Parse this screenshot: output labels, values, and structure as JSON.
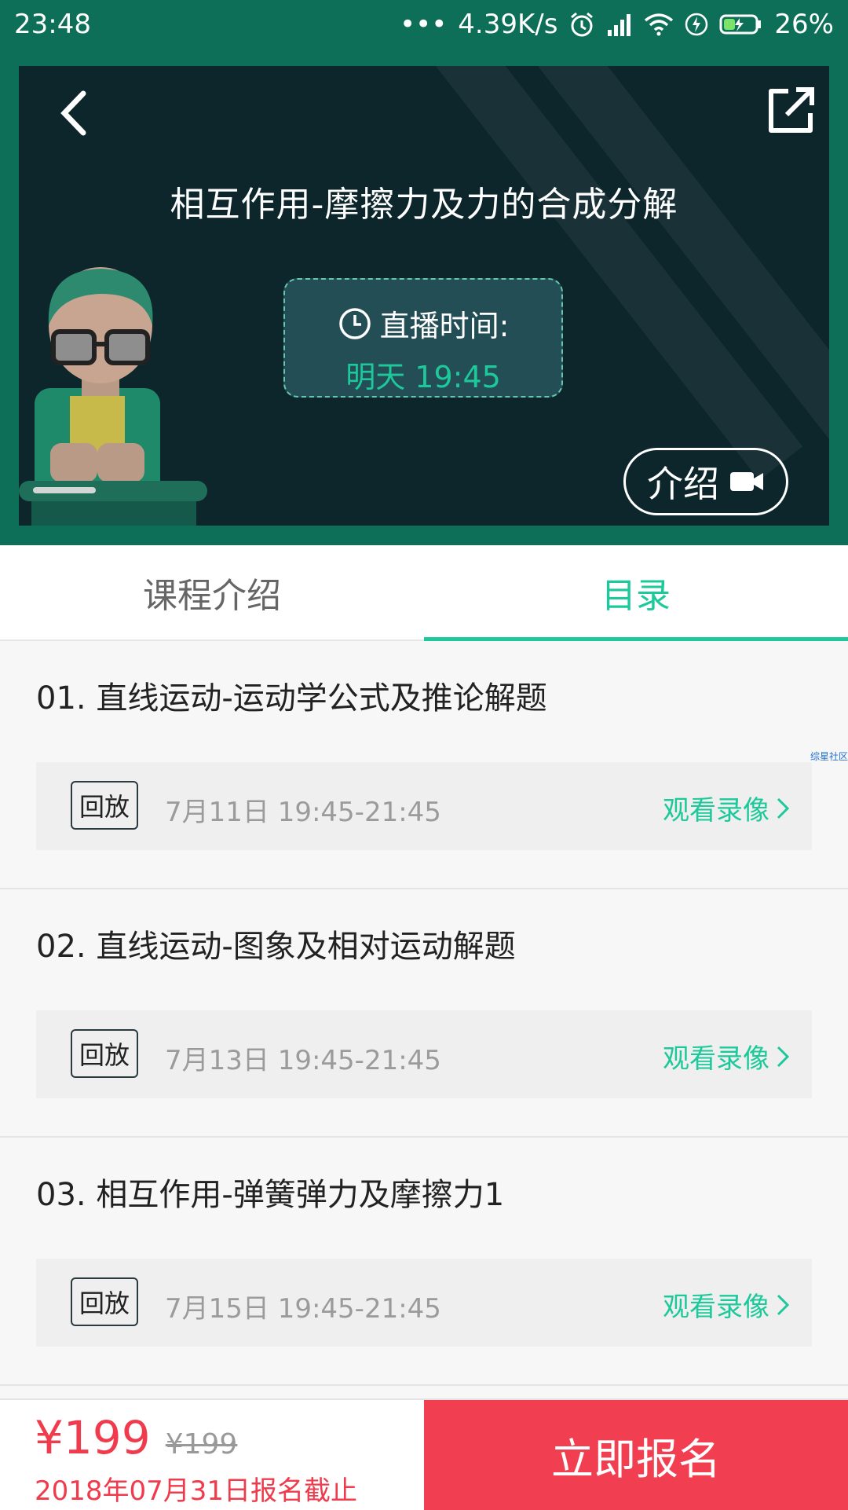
{
  "status_bar": {
    "time": "23:48",
    "dots": "•••",
    "net_speed": "4.39K/s",
    "battery": "26%"
  },
  "header": {
    "title": "相互作用-摩擦力及力的合成分解",
    "live_label": "直播时间:",
    "live_time": "明天  19:45",
    "intro_label": "介绍"
  },
  "tabs": [
    {
      "label": "课程介绍",
      "active": false
    },
    {
      "label": "目录",
      "active": true
    }
  ],
  "lessons": [
    {
      "title": "01. 直线运动-运动学公式及推论解题",
      "badge": "回放",
      "time": "7月11日 19:45-21:45",
      "action": "观看录像"
    },
    {
      "title": "02. 直线运动-图象及相对运动解题",
      "badge": "回放",
      "time": "7月13日 19:45-21:45",
      "action": "观看录像"
    },
    {
      "title": "03. 相互作用-弹簧弹力及摩擦力1",
      "badge": "回放",
      "time": "7月15日 19:45-21:45",
      "action": "观看录像"
    }
  ],
  "watermark": "综星社区",
  "footer": {
    "price": "¥199",
    "original_price": "¥199",
    "deadline": "2018年07月31日报名截止",
    "enroll_label": "立即报名"
  },
  "colors": {
    "brand_green": "#1dc99b",
    "header_green": "#0d6f57",
    "banner_bg": "#0c262b",
    "price_red": "#f03b4d"
  }
}
